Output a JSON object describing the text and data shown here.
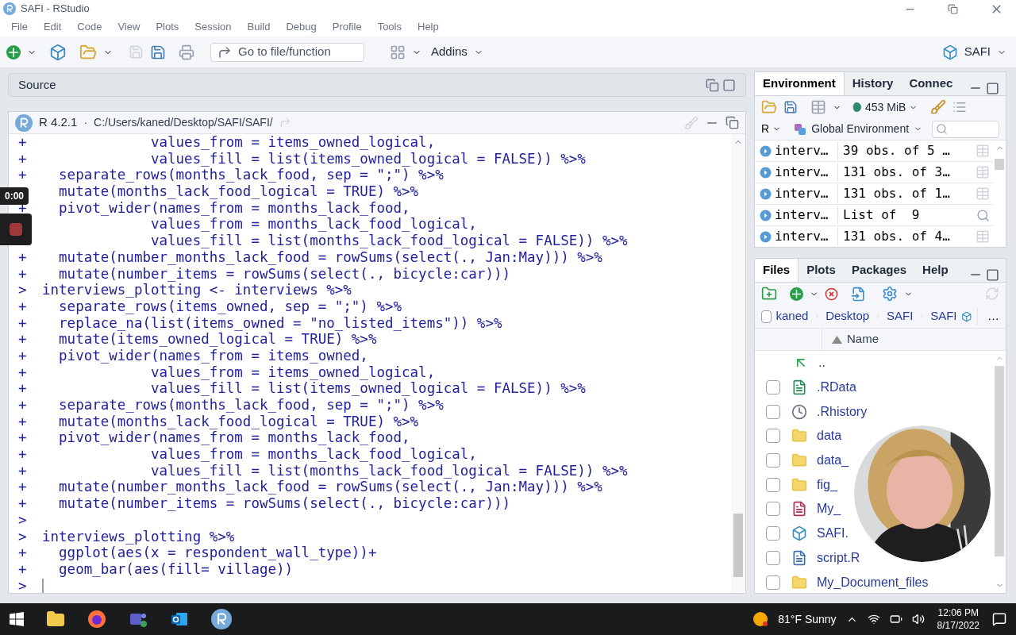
{
  "window": {
    "title": "SAFI - RStudio"
  },
  "menu": [
    "File",
    "Edit",
    "Code",
    "View",
    "Plots",
    "Session",
    "Build",
    "Debug",
    "Profile",
    "Tools",
    "Help"
  ],
  "toolbar": {
    "search_placeholder": "Go to file/function",
    "addins": "Addins",
    "project": "SAFI"
  },
  "source_pane": {
    "title": "Source"
  },
  "console": {
    "version": "R 4.2.1",
    "separator": "·",
    "path": "C:/Users/kaned/Desktop/SAFI/SAFI/",
    "lines": [
      {
        "prompt": "+",
        "code": "             values_from = items_owned_logical,"
      },
      {
        "prompt": "+",
        "code": "             values_fill = list(items_owned_logical = FALSE)) %>%"
      },
      {
        "prompt": "+",
        "code": "  separate_rows(months_lack_food, sep = \";\") %>%"
      },
      {
        "code": "  mutate(months_lack_food_logical = TRUE) %>%"
      },
      {
        "prompt": "+",
        "code": "  pivot_wider(names_from = months_lack_food,"
      },
      {
        "code": "             values_from = months_lack_food_logical,"
      },
      {
        "code": "             values_fill = list(months_lack_food_logical = FALSE)) %>%"
      },
      {
        "prompt": "+",
        "code": "  mutate(number_months_lack_food = rowSums(select(., Jan:May))) %>%"
      },
      {
        "prompt": "+",
        "code": "  mutate(number_items = rowSums(select(., bicycle:car)))"
      },
      {
        "prompt": ">",
        "code": "interviews_plotting <- interviews %>%"
      },
      {
        "prompt": "+",
        "code": "  separate_rows(items_owned, sep = \";\") %>%"
      },
      {
        "prompt": "+",
        "code": "  replace_na(list(items_owned = \"no_listed_items\")) %>%"
      },
      {
        "prompt": "+",
        "code": "  mutate(items_owned_logical = TRUE) %>%"
      },
      {
        "prompt": "+",
        "code": "  pivot_wider(names_from = items_owned,"
      },
      {
        "prompt": "+",
        "code": "             values_from = items_owned_logical,"
      },
      {
        "prompt": "+",
        "code": "             values_fill = list(items_owned_logical = FALSE)) %>%"
      },
      {
        "prompt": "+",
        "code": "  separate_rows(months_lack_food, sep = \";\") %>%"
      },
      {
        "prompt": "+",
        "code": "  mutate(months_lack_food_logical = TRUE) %>%"
      },
      {
        "prompt": "+",
        "code": "  pivot_wider(names_from = months_lack_food,"
      },
      {
        "prompt": "+",
        "code": "             values_from = months_lack_food_logical,"
      },
      {
        "prompt": "+",
        "code": "             values_fill = list(months_lack_food_logical = FALSE)) %>%"
      },
      {
        "prompt": "+",
        "code": "  mutate(number_months_lack_food = rowSums(select(., Jan:May))) %>%"
      },
      {
        "prompt": "+",
        "code": "  mutate(number_items = rowSums(select(., bicycle:car)))"
      },
      {
        "prompt": ">"
      },
      {
        "prompt": ">",
        "code": "interviews_plotting %>%"
      },
      {
        "prompt": "+",
        "code": "  ggplot(aes(x = respondent_wall_type))+"
      },
      {
        "prompt": "+",
        "code": "  geom_bar(aes(fill= village))"
      },
      {
        "prompt": ">",
        "cursor": true
      }
    ]
  },
  "environment": {
    "tabs": [
      {
        "label": "Environment",
        "selected": true
      },
      {
        "label": "History",
        "selected": false
      },
      {
        "label": "Connec",
        "selected": false
      }
    ],
    "memory": "453 MiB",
    "language": "R",
    "scope": "Global Environment",
    "rows": [
      {
        "name": "interv…",
        "value": "39 obs. of 5 …",
        "kind": "table"
      },
      {
        "name": "interv…",
        "value": "131 obs. of 3…",
        "kind": "table"
      },
      {
        "name": "interv…",
        "value": "131 obs. of 1…",
        "kind": "table"
      },
      {
        "name": "interv…",
        "value": "List of  9",
        "kind": "list"
      },
      {
        "name": "interv…",
        "value": "131 obs. of 4…",
        "kind": "table"
      }
    ]
  },
  "files": {
    "tabs": [
      {
        "label": "Files",
        "selected": true
      },
      {
        "label": "Plots",
        "selected": false
      },
      {
        "label": "Packages",
        "selected": false
      },
      {
        "label": "Help",
        "selected": false
      }
    ],
    "select_all_checked": false,
    "breadcrumb": [
      "kaned",
      "Desktop",
      "SAFI",
      "SAFI"
    ],
    "more": "…",
    "column": "Name",
    "parent": "..",
    "items": [
      {
        "name": ".RData",
        "kind": "rdata",
        "checked": false
      },
      {
        "name": ".Rhistory",
        "kind": "history",
        "checked": false
      },
      {
        "name": "data",
        "kind": "folder",
        "checked": false
      },
      {
        "name": "data_",
        "kind": "folder",
        "checked": false
      },
      {
        "name": "fig_",
        "kind": "folder",
        "checked": false
      },
      {
        "name": "My_",
        "kind": "rmd",
        "checked": false
      },
      {
        "name": "SAFI.",
        "kind": "project",
        "checked": false
      },
      {
        "name": "script.R",
        "kind": "rscript",
        "checked": false
      },
      {
        "name": "My_Document_files",
        "kind": "folder",
        "checked": false
      }
    ]
  },
  "recorder": {
    "time": "0:00"
  },
  "taskbar": {
    "weather": "81°F Sunny",
    "time": "12:06 PM",
    "date": "8/17/2022"
  }
}
